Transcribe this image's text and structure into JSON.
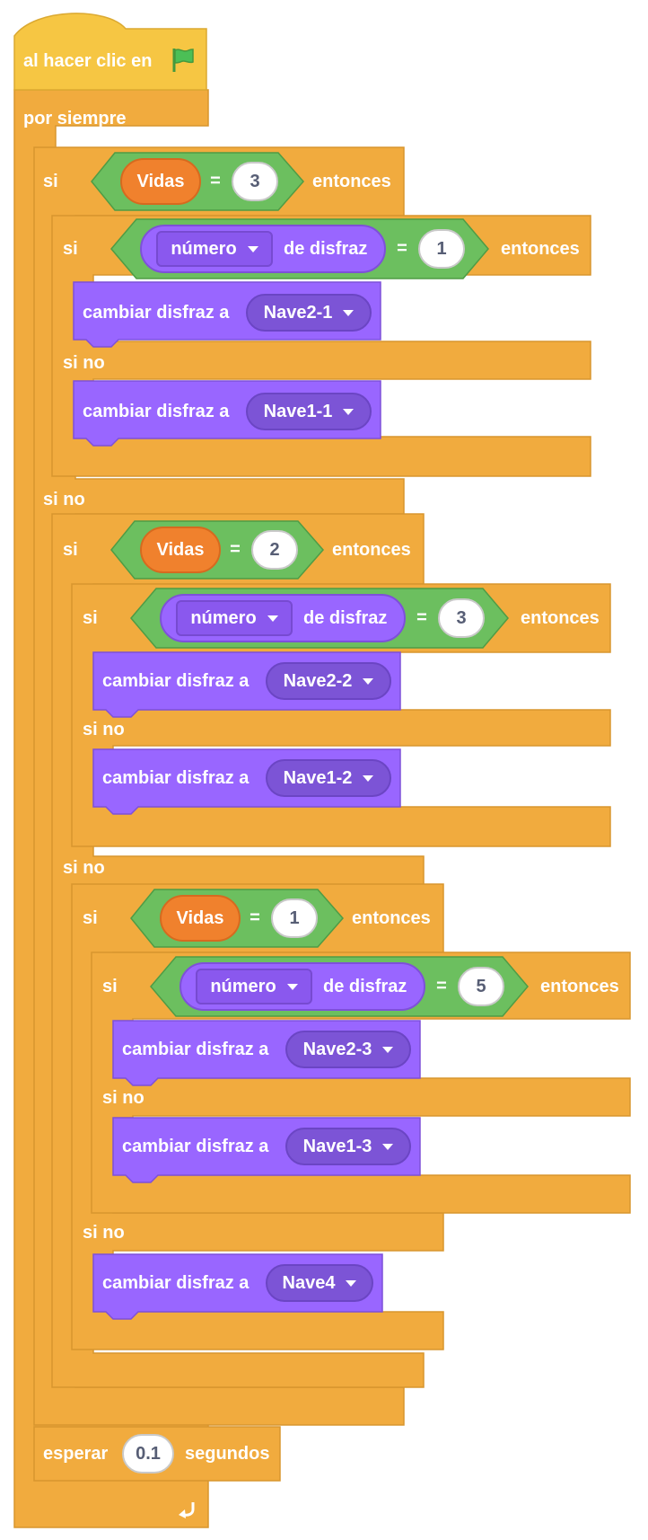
{
  "hat": {
    "label": "al hacer clic en",
    "icon": "green-flag-icon"
  },
  "forever": {
    "label": "por siempre",
    "icon": "loop-arrow-icon"
  },
  "ops": {
    "if": "si",
    "then": "entonces",
    "else": "si no",
    "equals": "="
  },
  "vars": {
    "lives": "Vidas"
  },
  "costume_reporter": {
    "option": "número",
    "suffix": "de disfraz"
  },
  "switch_costume": "cambiar disfraz a",
  "branches": [
    {
      "lives_value": "3",
      "costume_number": "1",
      "costume_then": "Nave2-1",
      "costume_else": "Nave1-1"
    },
    {
      "lives_value": "2",
      "costume_number": "3",
      "costume_then": "Nave2-2",
      "costume_else": "Nave1-2"
    },
    {
      "lives_value": "1",
      "costume_number": "5",
      "costume_then": "Nave2-3",
      "costume_else": "Nave1-3"
    }
  ],
  "final_costume": "Nave4",
  "wait": {
    "label": "esperar",
    "value": "0.1",
    "unit": "segundos"
  },
  "colors": {
    "control": "#f1ab3e",
    "control_edge": "#d8962e",
    "events": "#f6c643",
    "operators": "#6cbf5f",
    "looks": "#9966ff",
    "variables": "#f0812d"
  }
}
